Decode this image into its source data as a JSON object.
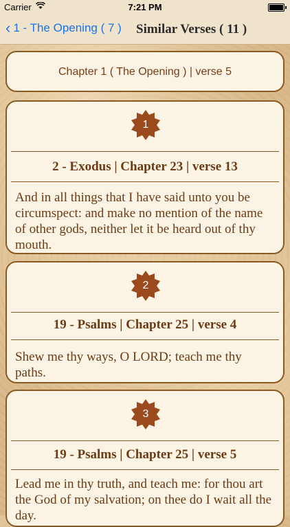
{
  "status": {
    "carrier": "Carrier",
    "wifi_icon": "wifi-icon",
    "time": "7:21 PM"
  },
  "nav": {
    "back_label": "1 - The Opening ( 7 )",
    "title": "Similar Verses ( 11 )"
  },
  "chapter": {
    "label": "Chapter 1 ( The Opening  ) | verse 5"
  },
  "verses": [
    {
      "number": "1",
      "reference": "2 - Exodus | Chapter 23 | verse 13",
      "text": "And in all things that I have said unto you be circumspect: and make no mention of the name of other gods, neither let it be heard out of thy mouth."
    },
    {
      "number": "2",
      "reference": "19 - Psalms | Chapter 25 | verse 4",
      "text": "Shew me thy ways, O LORD; teach me thy paths."
    },
    {
      "number": "3",
      "reference": "19 - Psalms | Chapter 25 | verse 5",
      "text": "Lead me in thy truth, and teach me: for thou art the God of my salvation; on thee do I wait all the day."
    }
  ],
  "colors": {
    "accent": "#1a73e8",
    "card_border": "#8a5a24",
    "badge": "#9a4a1c",
    "text": "#6b3b16"
  }
}
